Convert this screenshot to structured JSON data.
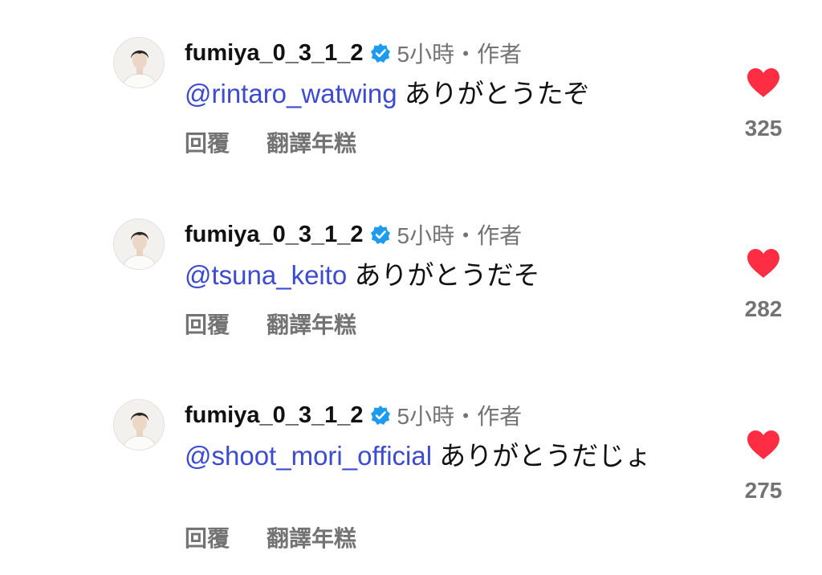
{
  "comments": [
    {
      "username": "fumiya_0_3_1_2",
      "time": "5小時・作者",
      "mention": "@rintaro_watwing",
      "text": " ありがとうたぞ",
      "reply_label": "回覆",
      "translate_label": "翻譯年糕",
      "likes": "325"
    },
    {
      "username": "fumiya_0_3_1_2",
      "time": "5小時・作者",
      "mention": "@tsuna_keito",
      "text": " ありがとうだそ",
      "reply_label": "回覆",
      "translate_label": "翻譯年糕",
      "likes": "282"
    },
    {
      "username": "fumiya_0_3_1_2",
      "time": "5小時・作者",
      "mention": "@shoot_mori_official",
      "text": " ありがとうだじょ",
      "reply_label": "回覆",
      "translate_label": "翻譯年糕",
      "likes": "275"
    }
  ],
  "colors": {
    "mention": "#3c4bd0",
    "heart": "#ff2d43",
    "verified": "#1d9bf0",
    "muted": "#737373"
  },
  "icons": {
    "verified": "verified-badge-icon",
    "like": "heart-icon",
    "avatar": "avatar-photo"
  }
}
